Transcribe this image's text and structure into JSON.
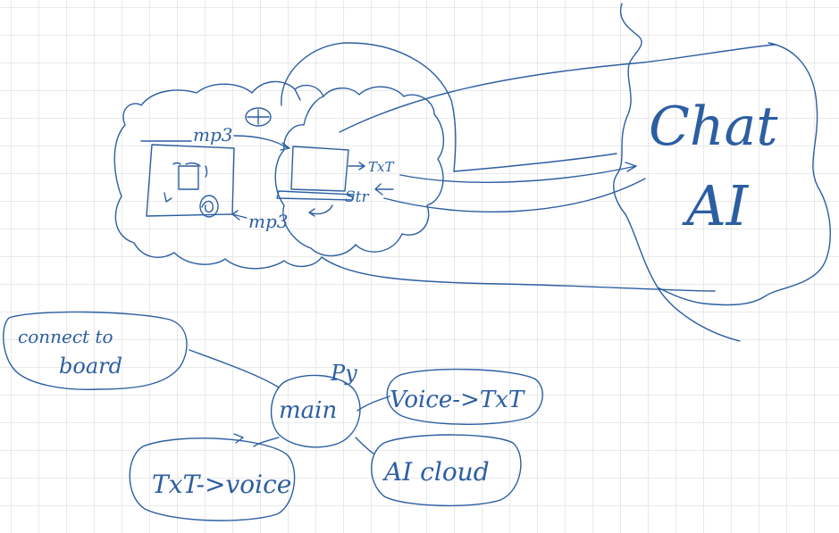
{
  "colors": {
    "ink": "#2c5ea2",
    "grid": "#e9e9e9",
    "background": "#ffffff"
  },
  "labels": {
    "mp3_in": "mp3",
    "mp3_out": "mp3",
    "txt_out": "TxT",
    "str_in": "Str",
    "plus_symbol": "+",
    "chat": "Chat",
    "ai": "AI",
    "py": "Py"
  },
  "nodes": {
    "main": "main",
    "connect_line1": "connect to",
    "connect_line2": "board",
    "voice_to_txt": "Voice->TxT",
    "ai_cloud": "AI cloud",
    "txt_to_voice": "TxT->voice"
  },
  "icons": {
    "device": "board-device-icon",
    "speaker": "speaker-icon",
    "laptop": "laptop-icon",
    "plus": "plus-icon"
  }
}
